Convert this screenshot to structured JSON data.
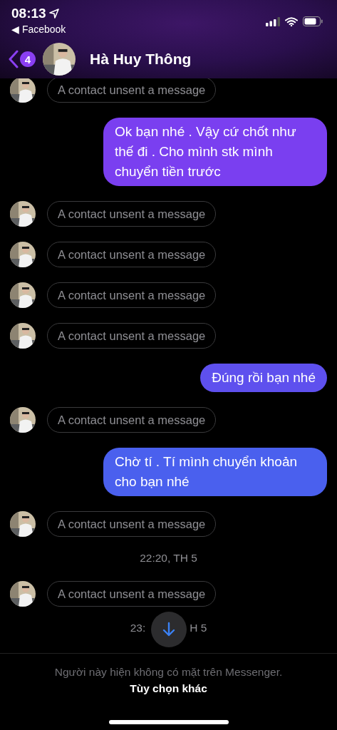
{
  "status_bar": {
    "time": "08:13",
    "back_label": "◀ Facebook"
  },
  "header": {
    "badge": "4",
    "name": "Hà Huy Thông"
  },
  "messages": [
    {
      "kind": "unsent",
      "text": "A contact unsent a message"
    },
    {
      "kind": "sent",
      "text": "Ok bạn nhé . Vậy cứ chốt như thế đi . Cho mình stk mình chuyển tiền trước",
      "color": "#7a3ff0"
    },
    {
      "kind": "unsent",
      "text": "A contact unsent a message"
    },
    {
      "kind": "unsent",
      "text": "A contact unsent a message"
    },
    {
      "kind": "unsent",
      "text": "A contact unsent a message"
    },
    {
      "kind": "unsent",
      "text": "A contact unsent a message"
    },
    {
      "kind": "sent",
      "text": "Đúng rồi bạn nhé",
      "color": "#5e50ee"
    },
    {
      "kind": "unsent",
      "text": "A contact unsent a message"
    },
    {
      "kind": "sent",
      "text": "Chờ tí . Tí mình chuyển khoản cho bạn nhé",
      "color": "#4a60ee"
    },
    {
      "kind": "unsent",
      "text": "A contact unsent a message"
    },
    {
      "kind": "time",
      "parts": [
        "22:20, TH 5"
      ]
    },
    {
      "kind": "unsent",
      "text": "A contact unsent a message"
    },
    {
      "kind": "time",
      "parts": [
        "23:",
        "H 5"
      ]
    }
  ],
  "footer": {
    "notice": "Người này hiện không có mặt trên Messenger.",
    "link": "Tùy chọn khác"
  }
}
